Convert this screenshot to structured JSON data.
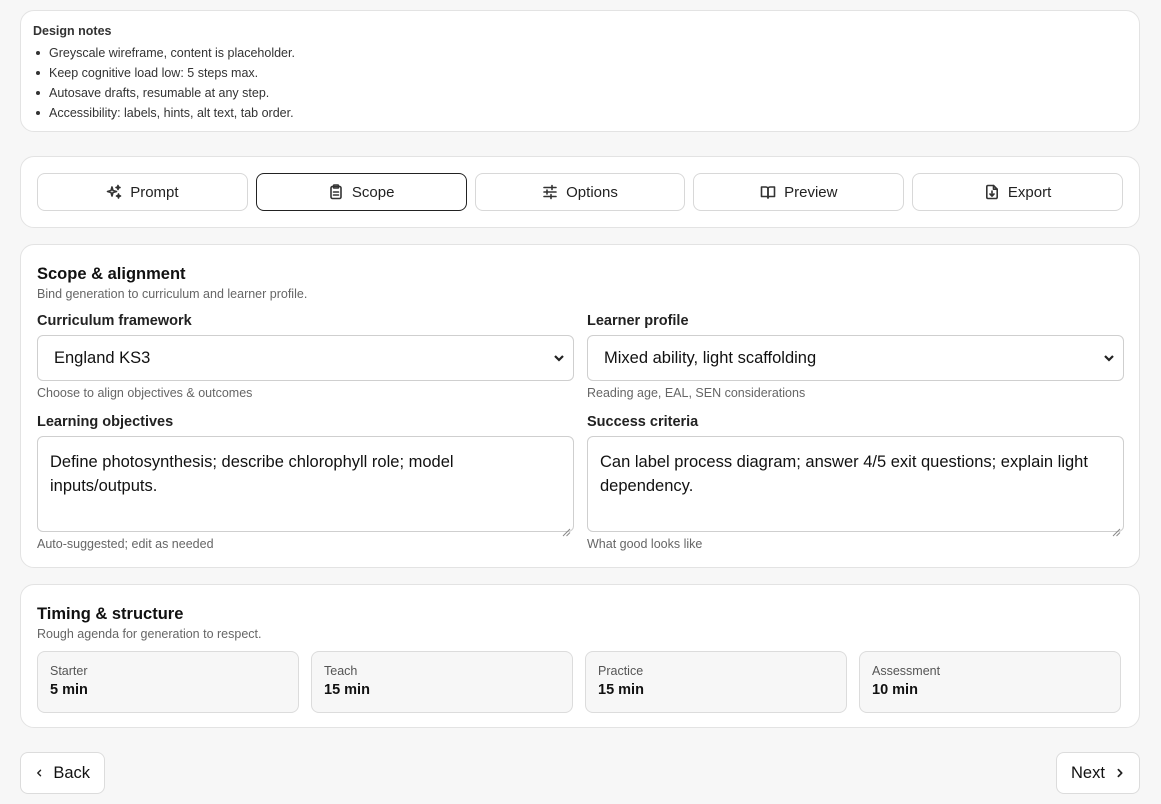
{
  "notes": {
    "title": "Design notes",
    "items": [
      "Greyscale wireframe, content is placeholder.",
      "Keep cognitive load low: 5 steps max.",
      "Autosave drafts, resumable at any step.",
      "Accessibility: labels, hints, alt text, tab order."
    ]
  },
  "steps": [
    {
      "label": "Prompt",
      "icon": "sparkles-icon"
    },
    {
      "label": "Scope",
      "icon": "clipboard-icon",
      "active": true
    },
    {
      "label": "Options",
      "icon": "sliders-icon"
    },
    {
      "label": "Preview",
      "icon": "book-open-icon"
    },
    {
      "label": "Export",
      "icon": "file-download-icon"
    }
  ],
  "scope": {
    "title": "Scope & alignment",
    "description": "Bind generation to curriculum and learner profile.",
    "curriculum": {
      "label": "Curriculum framework",
      "value": "England KS3",
      "hint": "Choose to align objectives & outcomes"
    },
    "learner": {
      "label": "Learner profile",
      "value": "Mixed ability, light scaffolding",
      "hint": "Reading age, EAL, SEN considerations"
    },
    "objectives": {
      "label": "Learning objectives",
      "value": "Define photosynthesis; describe chlorophyll role; model inputs/outputs.",
      "hint": "Auto-suggested; edit as needed"
    },
    "success": {
      "label": "Success criteria",
      "value": "Can label process diagram; answer 4/5 exit questions; explain light dependency.",
      "hint": "What good looks like"
    }
  },
  "timing": {
    "title": "Timing & structure",
    "description": "Rough agenda for generation to respect.",
    "tiles": [
      {
        "label": "Starter",
        "value": "5 min"
      },
      {
        "label": "Teach",
        "value": "15 min"
      },
      {
        "label": "Practice",
        "value": "15 min"
      },
      {
        "label": "Assessment",
        "value": "10 min"
      }
    ]
  },
  "nav": {
    "back": "Back",
    "next": "Next"
  }
}
